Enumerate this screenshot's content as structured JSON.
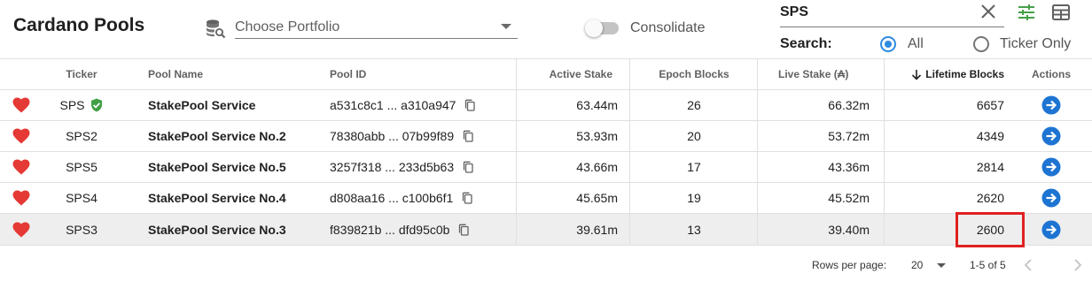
{
  "app": {
    "title": "Cardano Pools"
  },
  "portfolio": {
    "placeholder": "Choose Portfolio",
    "icon": "database-search-icon"
  },
  "consolidate": {
    "label": "Consolidate",
    "on": false
  },
  "search": {
    "value": "SPS",
    "label": "Search:",
    "options": [
      "All",
      "Ticker Only"
    ],
    "selected": "All"
  },
  "colors": {
    "accent": "#2d8be0",
    "heart": "#e53935",
    "verified": "#43a047",
    "filter_icon": "#43a047",
    "highlight_box": "#e02020",
    "row_highlight": "#eeeeee"
  },
  "table": {
    "headers": [
      "Ticker",
      "Pool Name",
      "Pool ID",
      "Active Stake",
      "Epoch Blocks",
      "Live Stake (₳)",
      "Lifetime Blocks",
      "Actions"
    ],
    "sort": {
      "column": "Lifetime Blocks",
      "direction": "desc"
    },
    "rows": [
      {
        "ticker": "SPS",
        "verified": true,
        "name": "StakePool Service",
        "pool_id": "a531c8c1 ... a310a947",
        "active_stake": "63.44m",
        "epoch_blocks": "26",
        "live_stake": "66.32m",
        "lifetime_blocks": "6657"
      },
      {
        "ticker": "SPS2",
        "verified": false,
        "name": "StakePool Service No.2",
        "pool_id": "78380abb ... 07b99f89",
        "active_stake": "53.93m",
        "epoch_blocks": "20",
        "live_stake": "53.72m",
        "lifetime_blocks": "4349"
      },
      {
        "ticker": "SPS5",
        "verified": false,
        "name": "StakePool Service No.5",
        "pool_id": "3257f318 ... 233d5b63",
        "active_stake": "43.66m",
        "epoch_blocks": "17",
        "live_stake": "43.36m",
        "lifetime_blocks": "2814"
      },
      {
        "ticker": "SPS4",
        "verified": false,
        "name": "StakePool Service No.4",
        "pool_id": "d808aa16 ... c100b6f1",
        "active_stake": "45.65m",
        "epoch_blocks": "19",
        "live_stake": "45.52m",
        "lifetime_blocks": "2620"
      },
      {
        "ticker": "SPS3",
        "verified": false,
        "name": "StakePool Service No.3",
        "pool_id": "f839821b ... dfd95c0b",
        "active_stake": "39.61m",
        "epoch_blocks": "13",
        "live_stake": "39.40m",
        "lifetime_blocks": "2600",
        "highlighted": true
      }
    ]
  },
  "pagination": {
    "rows_per_page_label": "Rows per page:",
    "rows_per_page": "20",
    "range": "1-5 of 5"
  }
}
